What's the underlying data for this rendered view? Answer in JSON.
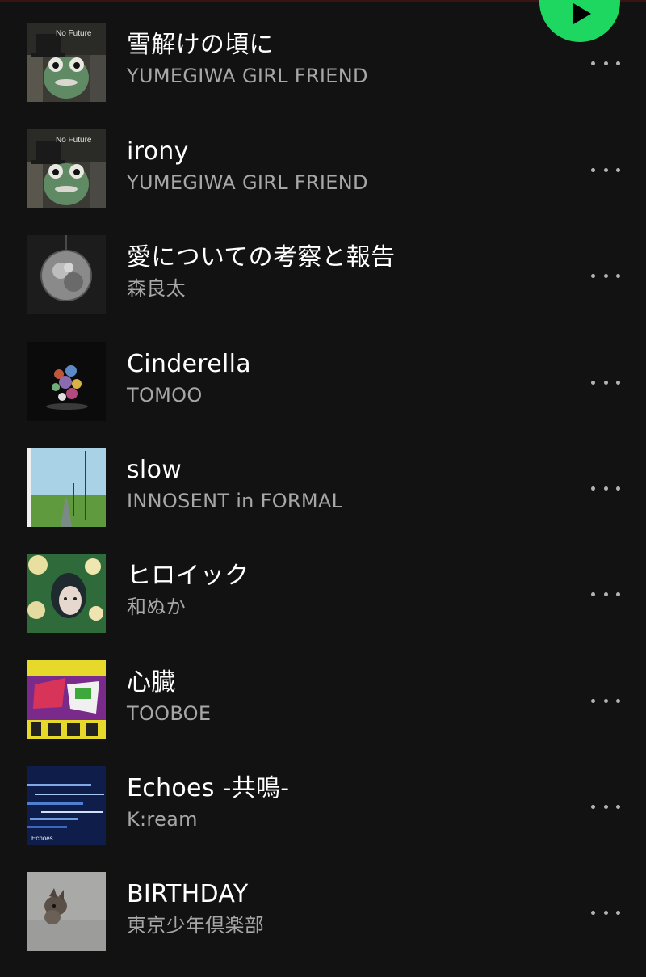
{
  "player": {
    "play_button_icon": "play-icon",
    "accent_color": "#1ed760"
  },
  "tracks": [
    {
      "title": "雪解けの頃に",
      "artist": "YUMEGIWA GIRL FRIEND",
      "cover_text": "No Future",
      "more_icon": "more-options-icon"
    },
    {
      "title": "irony",
      "artist": "YUMEGIWA GIRL FRIEND",
      "cover_text": "No Future",
      "more_icon": "more-options-icon"
    },
    {
      "title": "愛についての考察と報告",
      "artist": "森良太",
      "more_icon": "more-options-icon"
    },
    {
      "title": "Cinderella",
      "artist": "TOMOO",
      "more_icon": "more-options-icon"
    },
    {
      "title": "slow",
      "artist": "INNOSENT in FORMAL",
      "more_icon": "more-options-icon"
    },
    {
      "title": "ヒロイック",
      "artist": "和ぬか",
      "more_icon": "more-options-icon"
    },
    {
      "title": "心臓",
      "artist": "TOOBOE",
      "more_icon": "more-options-icon"
    },
    {
      "title": "Echoes -共鳴-",
      "artist": "K:ream",
      "cover_text": "Echoes",
      "more_icon": "more-options-icon"
    },
    {
      "title": "BIRTHDAY",
      "artist": "東京少年倶楽部",
      "more_icon": "more-options-icon"
    }
  ],
  "colors": {
    "background": "#121212",
    "title_text": "#ffffff",
    "artist_text": "#a7a7a7",
    "more_dots": "#b3b3b3"
  }
}
